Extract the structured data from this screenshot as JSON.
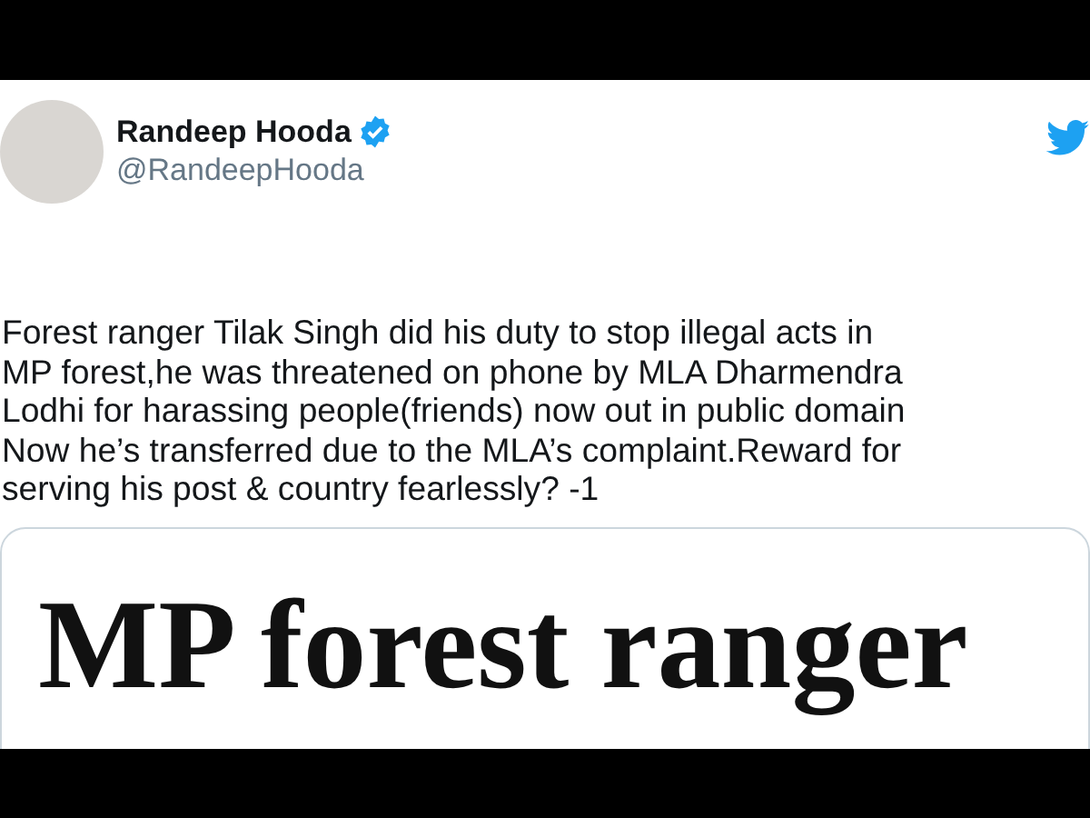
{
  "author": {
    "name": "Randeep Hooda",
    "handle": "@RandeepHooda",
    "verified": true
  },
  "tweet": {
    "text": "Forest ranger Tilak Singh did his duty to stop illegal acts in\nMP forest,he was threatened on phone by MLA Dharmendra\nLodhi for harassing people(friends) now out in public domain\nNow he’s transferred due to the MLA’s complaint.Reward for\nserving his post & country fearlessly? -1"
  },
  "attachment": {
    "headline": "MP forest ranger"
  }
}
